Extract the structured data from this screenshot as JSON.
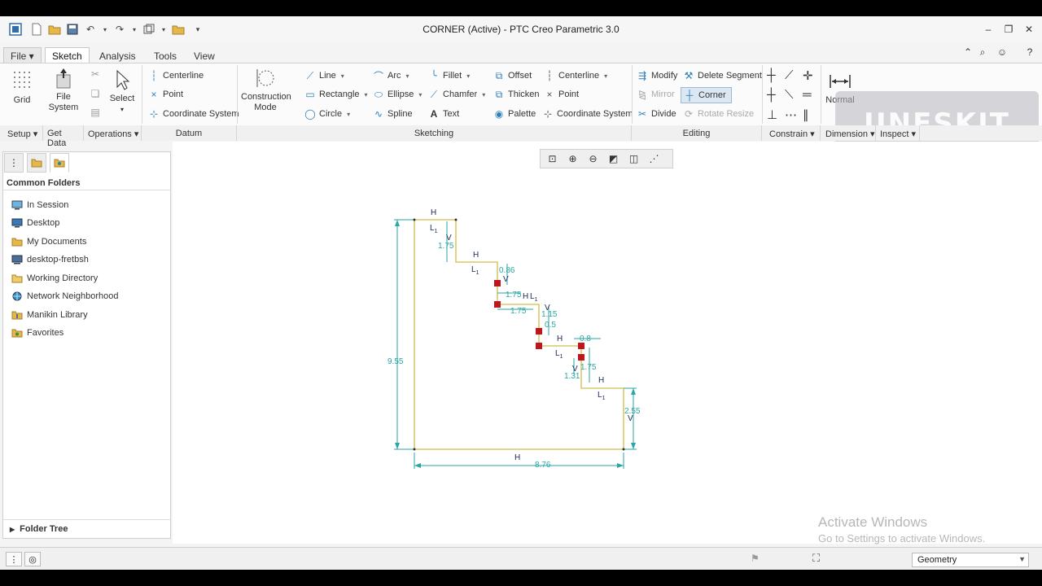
{
  "window": {
    "title": "CORNER (Active) - PTC Creo Parametric 3.0"
  },
  "tabs": [
    {
      "label": "File"
    },
    {
      "label": "Sketch"
    },
    {
      "label": "Analysis"
    },
    {
      "label": "Tools"
    },
    {
      "label": "View"
    }
  ],
  "ribbon": {
    "grid": "Grid",
    "file_system_1": "File",
    "file_system_2": "System",
    "select": "Select",
    "datum": {
      "centerline": "Centerline",
      "point": "Point",
      "coordinate_system": "Coordinate System"
    },
    "construction_1": "Construction",
    "construction_2": "Mode",
    "sketching": {
      "line": "Line",
      "rectangle": "Rectangle",
      "circle": "Circle",
      "arc": "Arc",
      "ellipse": "Ellipse",
      "spline": "Spline",
      "fillet": "Fillet",
      "chamfer": "Chamfer",
      "text": "Text",
      "offset": "Offset",
      "thicken": "Thicken",
      "palette": "Palette",
      "centerline": "Centerline",
      "point": "Point",
      "coordinate_system": "Coordinate System"
    },
    "editing": {
      "modify": "Modify",
      "delete_segment": "Delete Segment",
      "mirror": "Mirror",
      "corner": "Corner",
      "divide": "Divide",
      "rotate_resize": "Rotate Resize"
    },
    "normal": "Normal",
    "groups": {
      "setup": "Setup",
      "get_data": "Get Data",
      "operations": "Operations",
      "datum": "Datum",
      "sketching": "Sketching",
      "editing": "Editing",
      "constrain": "Constrain",
      "dimension": "Dimension",
      "inspect": "Inspect"
    }
  },
  "watermark": "UNESKIT",
  "navigator": {
    "header": "Common Folders",
    "items": [
      {
        "label": "In Session",
        "icon": "monitor-icon"
      },
      {
        "label": "Desktop",
        "icon": "desktop-icon"
      },
      {
        "label": "My Documents",
        "icon": "documents-folder-icon"
      },
      {
        "label": "desktop-fretbsh",
        "icon": "computer-icon"
      },
      {
        "label": "Working Directory",
        "icon": "folder-icon"
      },
      {
        "label": "Network Neighborhood",
        "icon": "network-icon"
      },
      {
        "label": "Manikin Library",
        "icon": "library-icon"
      },
      {
        "label": "Favorites",
        "icon": "favorites-icon"
      }
    ],
    "folder_tree": "Folder Tree"
  },
  "sketch": {
    "dimensions": {
      "height_total": "9.55",
      "width_total": "8.76",
      "right_height": "2.55",
      "step1_v": "1.75",
      "step2_v": "0.86",
      "step2_h": "1.75",
      "step2_h2": "1.75",
      "step3_v": "1.15",
      "step3_v2": "0.5",
      "step4_h": "0.8",
      "step4_v": "1.75",
      "step4_v2": "1.31"
    },
    "constraint_labels": {
      "h": "H",
      "v": "V",
      "l1": "L",
      "sub": "1"
    }
  },
  "activate": {
    "line1": "Activate Windows",
    "line2": "Go to Settings to activate Windows."
  },
  "status": {
    "filter": "Geometry"
  }
}
